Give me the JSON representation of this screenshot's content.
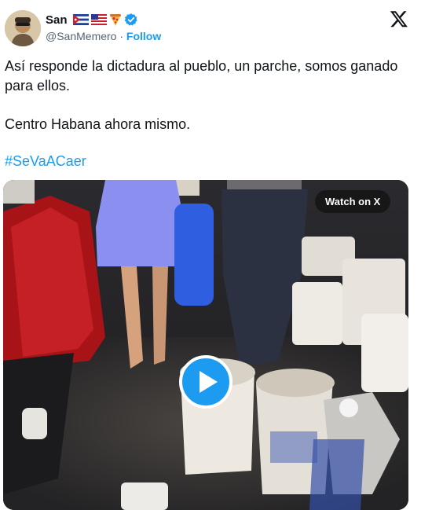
{
  "author": {
    "name": "San",
    "badges": [
      "cuba-flag-icon",
      "usa-flag-icon",
      "pizza-icon",
      "verified-badge-icon"
    ],
    "handle": "@SanMemero",
    "separator": "·",
    "follow_label": "Follow"
  },
  "brand": {
    "logo": "x-logo-icon"
  },
  "tweet": {
    "paragraph_1": "Así responde la dictadura al pueblo, un parche, somos ganado para ellos.",
    "paragraph_2": "Centro Habana ahora mismo.",
    "hashtag": "#SeVaACaer"
  },
  "media": {
    "type": "video",
    "watch_label": "Watch on X",
    "play_icon": "play-icon"
  },
  "colors": {
    "accent": "#1d9bf0",
    "text": "#0f1419",
    "secondary_text": "#536471",
    "dress": "#8b8ff0"
  }
}
